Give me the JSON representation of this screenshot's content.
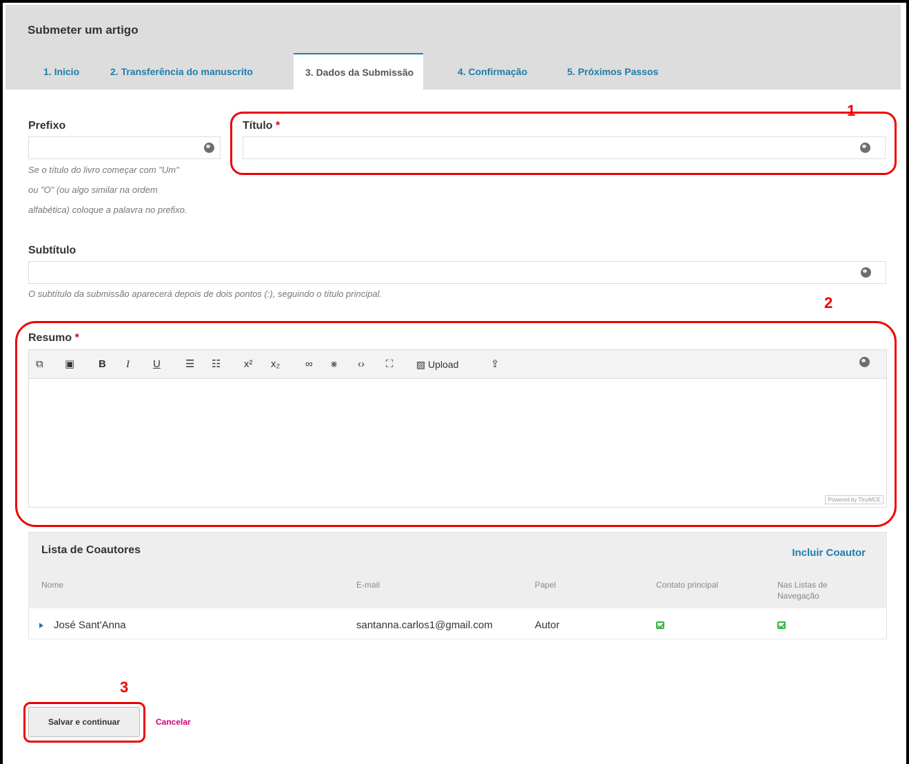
{
  "page": {
    "title": "Submeter um artigo"
  },
  "tabs": [
    {
      "label": "1. Inicio"
    },
    {
      "label": "2. Transferência do manuscrito"
    },
    {
      "label": "3. Dados da Submissão"
    },
    {
      "label": "4. Confirmação"
    },
    {
      "label": "5. Próximos Passos"
    }
  ],
  "fields": {
    "prefix": {
      "label": "Prefixo",
      "value": "",
      "hint_lines": [
        "Se o título do livro começar com \"Um\"",
        "ou \"O\" (ou algo similar na ordem",
        "alfabética) coloque a palavra no prefixo."
      ]
    },
    "title": {
      "label": "Título",
      "required_mark": "*",
      "value": ""
    },
    "subtitle": {
      "label": "Subtítulo",
      "value": "",
      "hint": "O subtítulo da submissão aparecerá depois de dois pontos (:), seguindo o título principal."
    },
    "abstract": {
      "label": "Resumo",
      "required_mark": "*",
      "powered_by": "Powered by TinyMCE"
    }
  },
  "toolbar": {
    "upload_label": "Upload",
    "buttons": [
      "copy-icon",
      "paste-icon",
      "bold-icon",
      "italic-icon",
      "underline-icon",
      "bullet-list-icon",
      "numbered-list-icon",
      "superscript-icon",
      "subscript-icon",
      "link-icon",
      "unlink-icon",
      "code-icon",
      "fullscreen-icon",
      "image-upload-icon",
      "file-upload-icon"
    ]
  },
  "coauthors": {
    "title": "Lista de Coautores",
    "add_label": "Incluir Coautor",
    "columns": [
      "Nome",
      "E-mail",
      "Papel",
      "Contato principal",
      "Nas Listas de Navegação"
    ],
    "rows": [
      {
        "name": "José Sant'Anna",
        "email": "santanna.carlos1@gmail.com",
        "role": "Autor",
        "primary_contact": true,
        "in_browse_lists": true
      }
    ]
  },
  "actions": {
    "save_label": "Salvar e continuar",
    "cancel_label": "Cancelar"
  },
  "annotations": [
    "1",
    "2",
    "3"
  ],
  "colors": {
    "accent": "#1e7cab",
    "annotation": "#e00000",
    "cancel": "#d0006f",
    "check": "#2fb53d"
  }
}
